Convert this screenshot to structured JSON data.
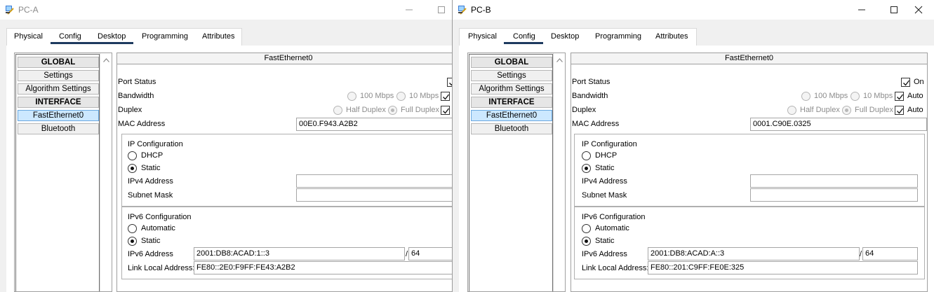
{
  "colors": {
    "selected": "#cce8ff",
    "tab_underline": "#1e3a5f"
  },
  "icons": {
    "app": "cisco-pt-pc-icon",
    "minimize": "minimize-icon",
    "maximize": "maximize-icon",
    "close": "close-icon"
  },
  "tabs": [
    "Physical",
    "Config",
    "Desktop",
    "Programming",
    "Attributes"
  ],
  "sidebar": {
    "global": "GLOBAL",
    "settings": "Settings",
    "algorithm": "Algorithm Settings",
    "interface": "INTERFACE",
    "fastethernet": "FastEthernet0",
    "bluetooth": "Bluetooth"
  },
  "panel": {
    "title": "FastEthernet0",
    "port_status": "Port Status",
    "on": "On",
    "bandwidth": "Bandwidth",
    "mbps100": "100 Mbps",
    "mbps10": "10 Mbps",
    "auto": "Auto",
    "duplex": "Duplex",
    "half": "Half Duplex",
    "full": "Full Duplex",
    "mac_label": "MAC Address",
    "ip_config": "IP Configuration",
    "dhcp": "DHCP",
    "static": "Static",
    "ipv4_label": "IPv4 Address",
    "subnet_label": "Subnet Mask",
    "ipv6_config": "IPv6 Configuration",
    "automatic": "Automatic",
    "ipv6_label": "IPv6 Address",
    "link_local_label": "Link Local Address:",
    "slash": "/"
  },
  "pc_a": {
    "title": "PC-A",
    "mac": "00E0.F943.A2B2",
    "ipv4": "",
    "subnet": "",
    "ipv6": "2001:DB8:ACAD:1::3",
    "prefix": "64",
    "link_local": "FE80::2E0:F9FF:FE43:A2B2"
  },
  "pc_b": {
    "title": "PC-B",
    "mac": "0001.C90E.0325",
    "ipv4": "",
    "subnet": "",
    "ipv6": "2001:DB8:ACAD:A::3",
    "prefix": "64",
    "link_local": "FE80::201:C9FF:FE0E:325"
  }
}
